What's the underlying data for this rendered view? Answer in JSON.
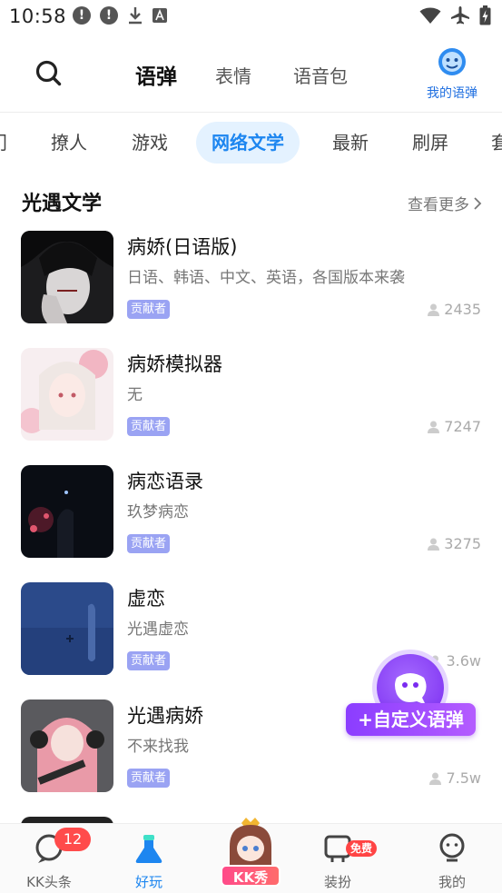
{
  "status_bar": {
    "time": "10:58"
  },
  "header": {
    "tabs": [
      {
        "label": "语弹",
        "active": true
      },
      {
        "label": "表情",
        "active": false
      },
      {
        "label": "语音包",
        "active": false
      }
    ],
    "my_yudan_label": "我的语弹"
  },
  "categories": {
    "items": [
      "门",
      "撩人",
      "游戏",
      "网络文学",
      "最新",
      "刷屏",
      "套"
    ],
    "active": "网络文学"
  },
  "section": {
    "title": "光遇文学",
    "see_more": "查看更多"
  },
  "items": [
    {
      "title": "病娇(日语版)",
      "subtitle": "日语、韩语、中文、英语，各国版本来袭",
      "badge": "贡献者",
      "count": "2435"
    },
    {
      "title": "病娇模拟器",
      "subtitle": "无",
      "badge": "贡献者",
      "count": "7247"
    },
    {
      "title": "病恋语录",
      "subtitle": "玖梦病恋",
      "badge": "贡献者",
      "count": "3275"
    },
    {
      "title": "虚恋",
      "subtitle": "光遇虚恋",
      "badge": "贡献者",
      "count": "3.6w"
    },
    {
      "title": "光遇病娇",
      "subtitle": "不来找我",
      "badge": "贡献者",
      "count": "7.5w"
    }
  ],
  "fab": {
    "label": "+自定义语弹"
  },
  "bottom_nav": {
    "items": [
      {
        "label": "KK头条",
        "badge": "12"
      },
      {
        "label": "好玩",
        "active": true
      },
      {
        "label": "KK秀"
      },
      {
        "label": "装扮",
        "badge": "免费"
      },
      {
        "label": "我的"
      }
    ]
  },
  "colors": {
    "accent": "#1d86f0",
    "active_chip_bg": "#e4f2ff",
    "badge_bg": "#9aa3f3",
    "fab_purple": "#8b3dff",
    "notification_red": "#ff4b4b"
  }
}
